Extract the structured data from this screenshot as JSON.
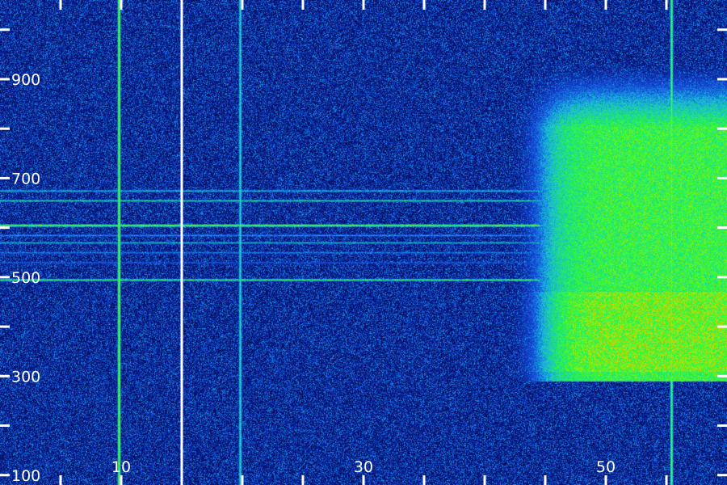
{
  "chart_data": {
    "type": "heatmap",
    "x_ticks": [
      10,
      30,
      50
    ],
    "x_tick_labels": [
      "10",
      "30",
      "50"
    ],
    "y_ticks": [
      100,
      300,
      500,
      700,
      900
    ],
    "y_tick_labels": [
      "100",
      "300",
      "500",
      "700",
      "900"
    ],
    "xlim": [
      0,
      60
    ],
    "ylim": [
      80,
      1060
    ],
    "colormap": [
      "#00003a",
      "#0a1f8c",
      "#1448d8",
      "#18b4e0",
      "#20e080",
      "#30ff30",
      "#c8e000",
      "#ff8800",
      "#ff2000"
    ],
    "divider_x": [
      15
    ],
    "vertical_lines": [
      {
        "x": 9.8,
        "intensity": 0.82
      },
      {
        "x": 19.8,
        "intensity": 0.55
      },
      {
        "x": 55.4,
        "intensity": 0.7
      }
    ],
    "horizontal_lines": [
      {
        "y": 605,
        "intensity": 0.78
      },
      {
        "y": 495,
        "intensity": 0.6
      },
      {
        "y": 655,
        "intensity": 0.5
      },
      {
        "y": 675,
        "intensity": 0.45
      },
      {
        "y": 570,
        "intensity": 0.42
      },
      {
        "y": 585,
        "intensity": 0.38
      },
      {
        "y": 550,
        "intensity": 0.35
      },
      {
        "y": 530,
        "intensity": 0.3
      }
    ],
    "bright_region": {
      "x": [
        44.5,
        60
      ],
      "y": [
        290,
        900
      ],
      "intensity": 0.62
    },
    "noise_level": 0.28
  }
}
